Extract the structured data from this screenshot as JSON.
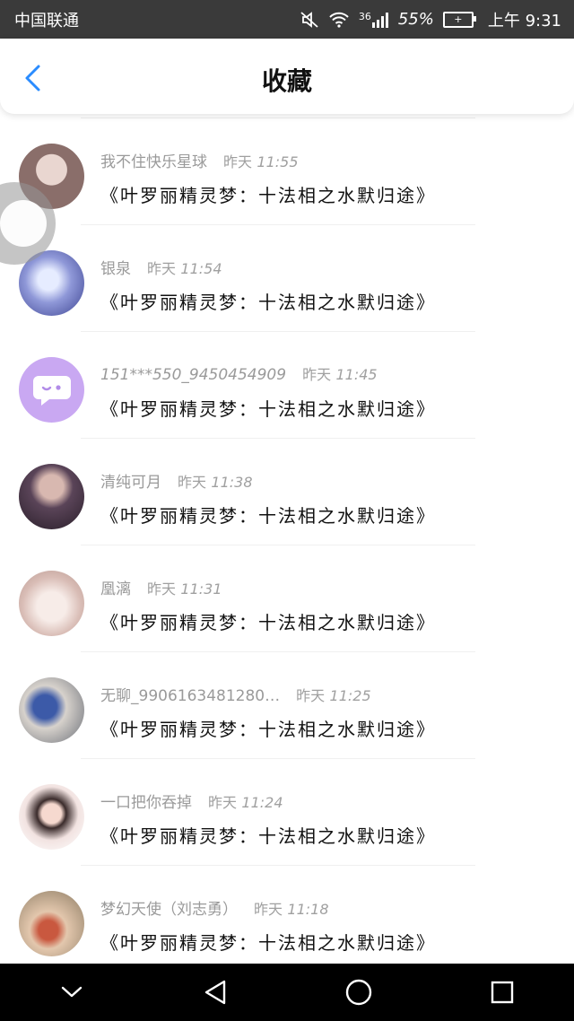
{
  "status_bar": {
    "carrier": "中国联通",
    "network": "36",
    "battery_percent": "55%",
    "time": "上午 9:31"
  },
  "header": {
    "title": "收藏",
    "back_icon": "chevron-left-icon",
    "accent_color": "#2a8cff"
  },
  "items": [
    {
      "name": "我不住快乐星球",
      "day": "昨天",
      "time": "11:55",
      "content": "《叶罗丽精灵梦：十法相之水默归途》",
      "avatar_color": "#8a6e6a"
    },
    {
      "name": "银泉",
      "day": "昨天",
      "time": "11:54",
      "content": "《叶罗丽精灵梦：十法相之水默归途》",
      "avatar_color": "#6c77c4"
    },
    {
      "name": "151***550_9450454909",
      "day": "昨天",
      "time": "11:45",
      "content": "《叶罗丽精灵梦：十法相之水默归途》",
      "avatar_color": "#c9a8f2"
    },
    {
      "name": "清纯可月",
      "day": "昨天",
      "time": "11:38",
      "content": "《叶罗丽精灵梦：十法相之水默归途》",
      "avatar_color": "#4e3b4a"
    },
    {
      "name": "凰漓",
      "day": "昨天",
      "time": "11:31",
      "content": "《叶罗丽精灵梦：十法相之水默归途》",
      "avatar_color": "#e8d2cc"
    },
    {
      "name": "无聊_9906163481280…",
      "day": "昨天",
      "time": "11:25",
      "content": "《叶罗丽精灵梦：十法相之水默归途》",
      "avatar_color": "#6b6f78"
    },
    {
      "name": "一口把你吞掉",
      "day": "昨天",
      "time": "11:24",
      "content": "《叶罗丽精灵梦：十法相之水默归途》",
      "avatar_color": "#f2e3e1"
    },
    {
      "name": "梦幻天使（刘志勇）",
      "day": "昨天",
      "time": "11:18",
      "content": "《叶罗丽精灵梦：十法相之水默归途》",
      "avatar_color": "#8a7a62"
    }
  ],
  "nav_bar": {
    "icons": [
      "chevron-down-icon",
      "back-triangle-icon",
      "home-circle-icon",
      "recent-square-icon"
    ]
  }
}
